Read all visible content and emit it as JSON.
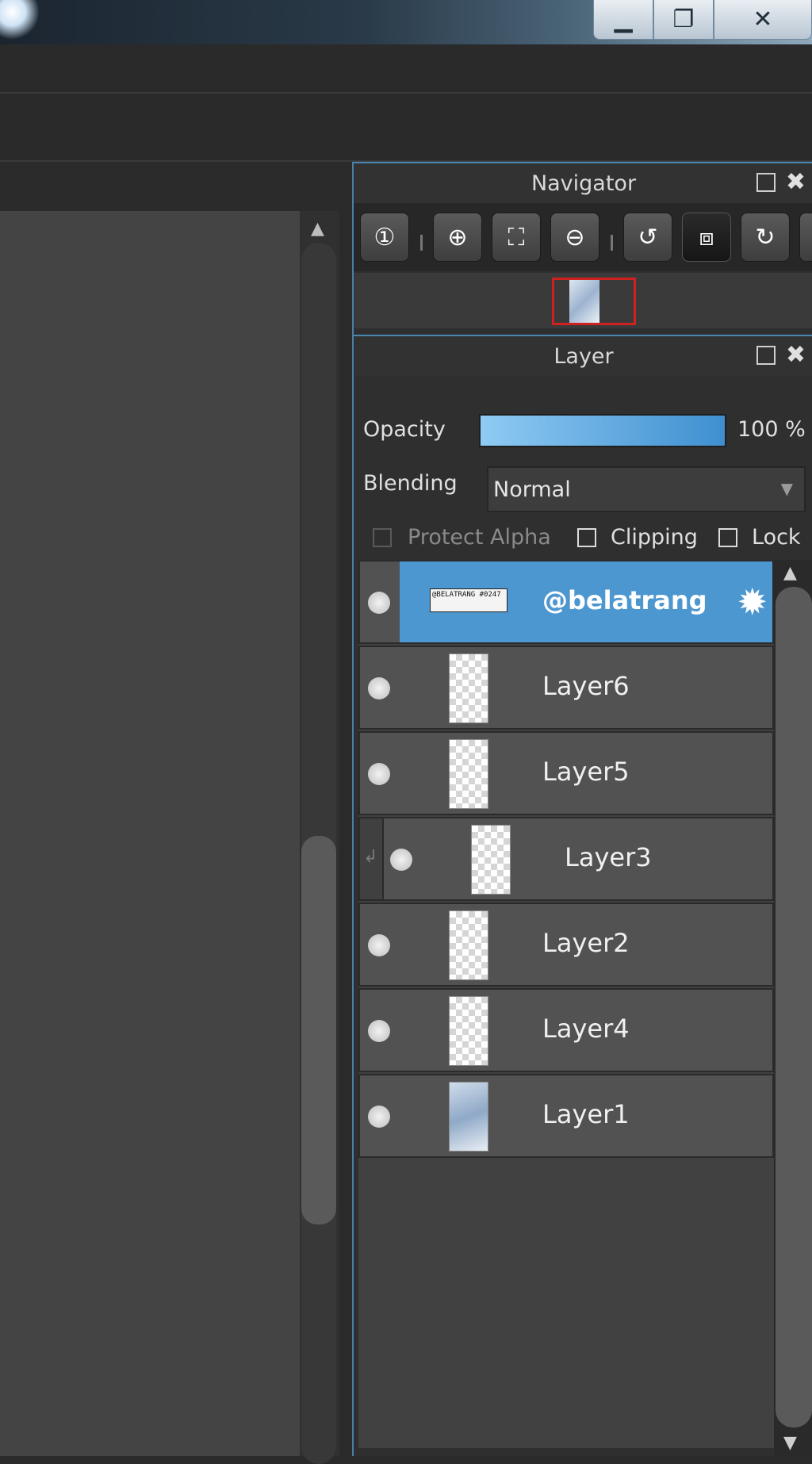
{
  "window": {
    "minimize_glyph": "▁",
    "restore_glyph": "❐",
    "close_glyph": "✕"
  },
  "navigator": {
    "title": "Navigator",
    "tools": [
      {
        "name": "zoom-actual-icon",
        "glyph": "①"
      },
      {
        "name": "zoom-in-icon",
        "glyph": "⊕"
      },
      {
        "name": "fit-screen-icon",
        "glyph": "⛶"
      },
      {
        "name": "zoom-out-icon",
        "glyph": "⊖"
      },
      {
        "name": "rotate-left-icon",
        "glyph": "↺"
      },
      {
        "name": "reset-rotation-icon",
        "glyph": "⧈"
      },
      {
        "name": "rotate-right-icon",
        "glyph": "↻"
      }
    ]
  },
  "layer_panel": {
    "title": "Layer",
    "opacity_label": "Opacity",
    "opacity_value": "100 %",
    "opacity_fraction": 1.0,
    "blending_label": "Blending",
    "blending_value": "Normal",
    "protect_alpha_label": "Protect Alpha",
    "clipping_label": "Clipping",
    "lock_label": "Lock",
    "layers": [
      {
        "name": "@belatrang",
        "selected": true,
        "thumb_text": "@BELATRANG\n#0247"
      },
      {
        "name": "Layer6"
      },
      {
        "name": "Layer5"
      },
      {
        "name": "Layer3",
        "clipped": true
      },
      {
        "name": "Layer2"
      },
      {
        "name": "Layer4"
      },
      {
        "name": "Layer1"
      }
    ]
  },
  "colors": {
    "selection": "#4d97d1",
    "accent_border": "#4a88b3",
    "preview_frame": "#d02020"
  }
}
